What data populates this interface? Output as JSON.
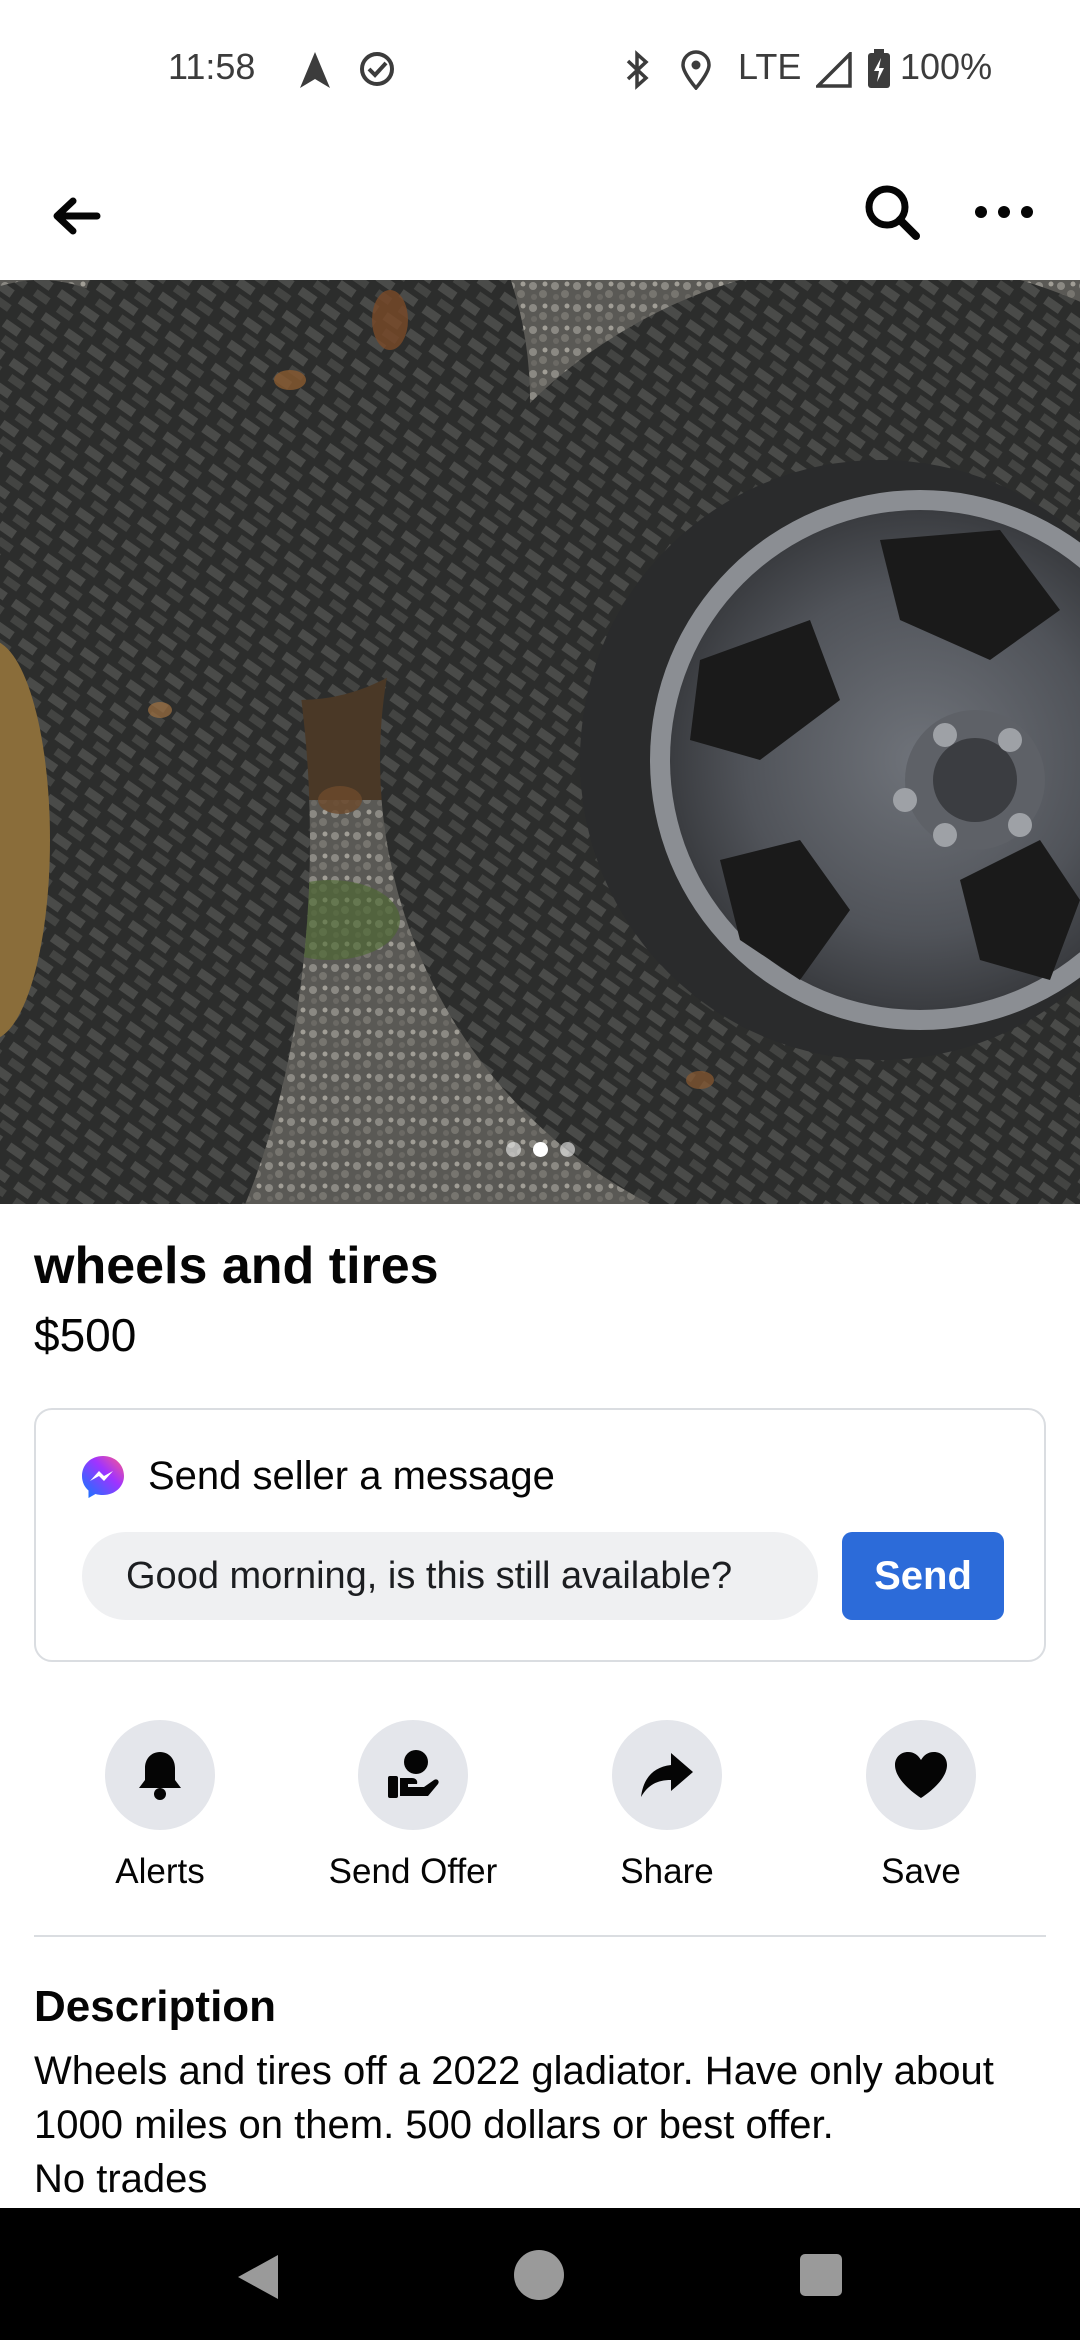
{
  "status_bar": {
    "time": "11:58",
    "network": "LTE",
    "battery": "100%"
  },
  "top_nav": {
    "back_icon": "arrow-left-icon",
    "search_icon": "search-icon",
    "more_icon": "more-dots-icon"
  },
  "photo": {
    "subject": "wheels and tires",
    "carousel_total": 3,
    "carousel_active": 2
  },
  "listing": {
    "title": "wheels and tires",
    "price": "$500"
  },
  "message": {
    "heading": "Send seller a message",
    "input_value": "Good morning, is this still available?",
    "send_label": "Send",
    "accent": "#2c6bd9"
  },
  "actions": [
    {
      "label": "Alerts",
      "icon": "bell-icon"
    },
    {
      "label": "Send Offer",
      "icon": "offer-hand-icon"
    },
    {
      "label": "Share",
      "icon": "share-arrow-icon"
    },
    {
      "label": "Save",
      "icon": "heart-icon"
    }
  ],
  "description": {
    "heading": "Description",
    "text": "Wheels and tires off a 2022 gladiator. Have only about 1000 miles on them. 500 dollars or best offer.\nNo trades"
  }
}
